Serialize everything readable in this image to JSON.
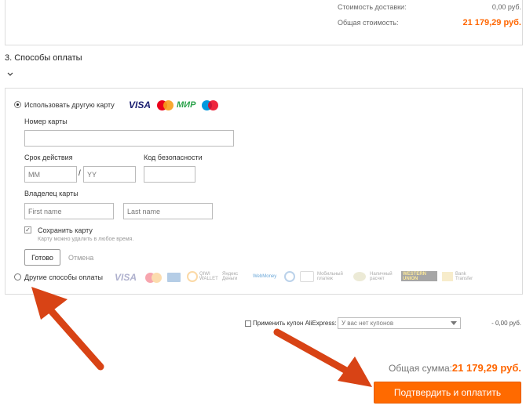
{
  "summary": {
    "delivery_label": "Стоимость доставки:",
    "delivery_value": "0,00 руб.",
    "total_label": "Общая стоимость:",
    "total_value": "21 179,29 руб."
  },
  "payment": {
    "section_title": "3. Способы оплаты",
    "collapse_icon": "chevron-down-icon",
    "other_card_label": "Использовать другую карту",
    "card_brands": [
      "VISA",
      "Mastercard",
      "МИР",
      "Maestro"
    ],
    "card_number_label": "Номер карты",
    "card_number_value": "",
    "expiry_label": "Срок действия",
    "month_placeholder": "MM",
    "year_placeholder": "YY",
    "separator": "/",
    "cvv_label": "Код безопасности",
    "holder_label": "Владелец карты",
    "first_name_placeholder": "First name",
    "last_name_placeholder": "Last name",
    "save_card_label": "Сохранить карту",
    "save_card_checked": true,
    "save_card_hint": "Карту можно удалить в любое время.",
    "done_button": "Готово",
    "cancel_button": "Отмена",
    "other_methods_label": "Другие способы оплаты",
    "other_methods": {
      "visa": "VISA",
      "qiwi": "QIWI WALLET",
      "yandex": "Яндекс Деньги",
      "webmoney": "WebMoney",
      "mobile": "Мобильный платеж",
      "cash": "Наличный расчет",
      "western_union": "WESTERN UNION",
      "bank": "Bank Transfer"
    }
  },
  "coupon": {
    "label": "Применить купон AliExpress:",
    "select_value": "У вас нет купонов",
    "discount_value": "- 0,00 руб."
  },
  "grand_total": {
    "label": "Общая сумма:",
    "value": "21 179,29 руб."
  },
  "confirm_button": "Подтвердить и оплатить",
  "colors": {
    "accent": "#ff6a00",
    "price": "#ff6600",
    "arrow": "#d84315"
  }
}
